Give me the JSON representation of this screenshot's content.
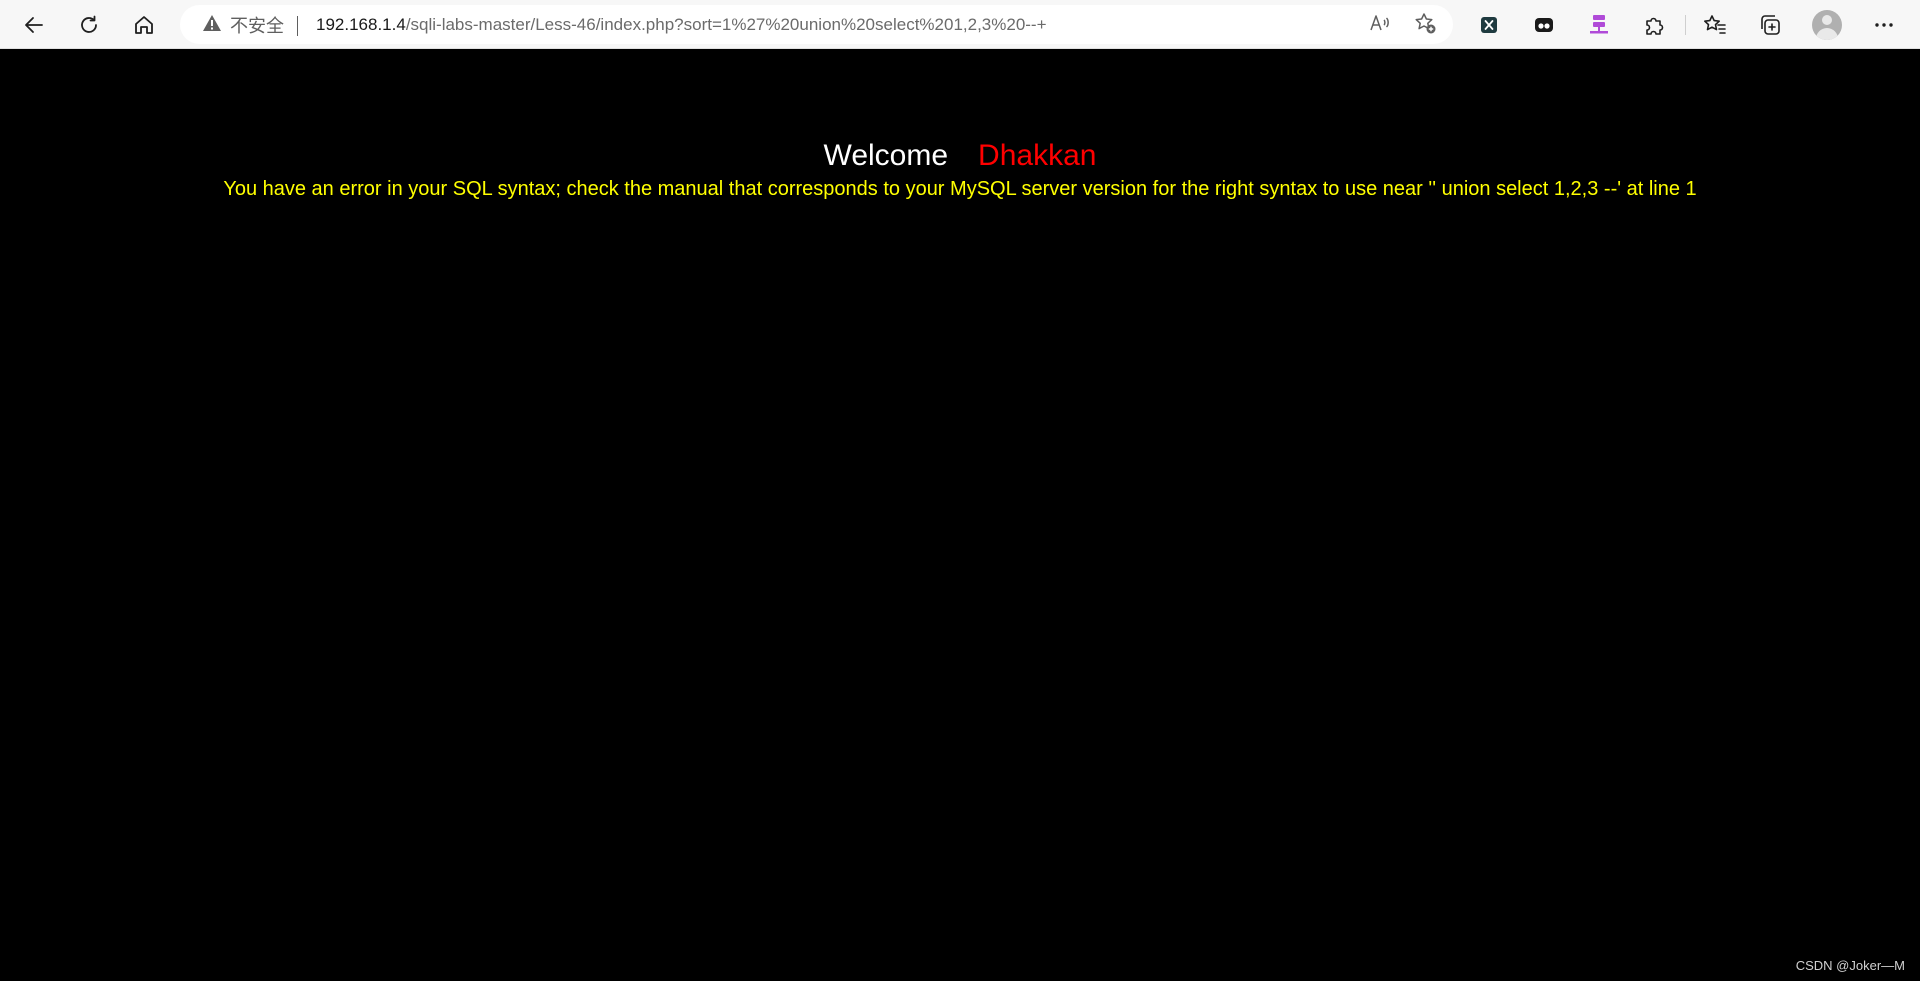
{
  "browser": {
    "address_bar": {
      "security_label": "不安全",
      "url_host": "192.168.1.4",
      "url_rest": "/sqli-labs-master/Less-46/index.php?sort=1%27%20union%20select%201,2,3%20--+"
    },
    "icons": {
      "back": "back-arrow-icon",
      "refresh": "refresh-icon",
      "home": "home-icon",
      "warning": "warning-triangle-icon",
      "read_aloud": "read-aloud-icon",
      "add_favorite": "add-favorite-icon",
      "extensions": [
        "excel-extension-icon",
        "hackbar-extension-icon",
        "network-extension-icon",
        "puzzle-extensions-icon"
      ],
      "favorites": "favorites-icon",
      "collections": "collections-icon",
      "profile": "profile-avatar",
      "more": "more-options-icon"
    }
  },
  "page": {
    "welcome_word": "Welcome",
    "welcome_name": "Dhakkan",
    "error_message": "You have an error in your SQL syntax; check the manual that corresponds to your MySQL server version for the right syntax to use near '' union select 1,2,3 --' at line 1",
    "colors": {
      "background": "#000000",
      "welcome": "#ffffff",
      "name": "#ff0000",
      "error": "#ffff00"
    }
  },
  "watermark": "CSDN @Joker—M"
}
